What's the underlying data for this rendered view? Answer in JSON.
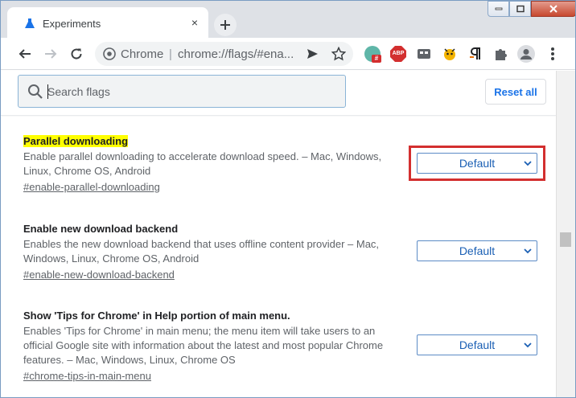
{
  "tab": {
    "title": "Experiments",
    "close_glyph": "×"
  },
  "omnibox": {
    "site": "Chrome",
    "separator": "|",
    "url": "chrome://flags/#ena..."
  },
  "extensions": {
    "abp_label": "ABP",
    "badge": "#"
  },
  "search": {
    "placeholder": "Search flags",
    "value": ""
  },
  "reset_label": "Reset all",
  "flags": [
    {
      "title": "Parallel downloading",
      "highlighted": true,
      "description": "Enable parallel downloading to accelerate download speed. – Mac, Windows, Linux, Chrome OS, Android",
      "link": "#enable-parallel-downloading",
      "value": "Default",
      "focused": true
    },
    {
      "title": "Enable new download backend",
      "highlighted": false,
      "description": "Enables the new download backend that uses offline content provider – Mac, Windows, Linux, Chrome OS, Android",
      "link": "#enable-new-download-backend",
      "value": "Default",
      "focused": false
    },
    {
      "title": "Show 'Tips for Chrome' in Help portion of main menu.",
      "highlighted": false,
      "description": "Enables 'Tips for Chrome' in main menu; the menu item will take users to an official Google site with information about the latest and most popular Chrome features. – Mac, Windows, Linux, Chrome OS",
      "link": "#chrome-tips-in-main-menu",
      "value": "Default",
      "focused": false
    }
  ],
  "colors": {
    "accent": "#1a73e8",
    "highlight": "#ffff00",
    "focus_frame": "#d32f2f"
  }
}
